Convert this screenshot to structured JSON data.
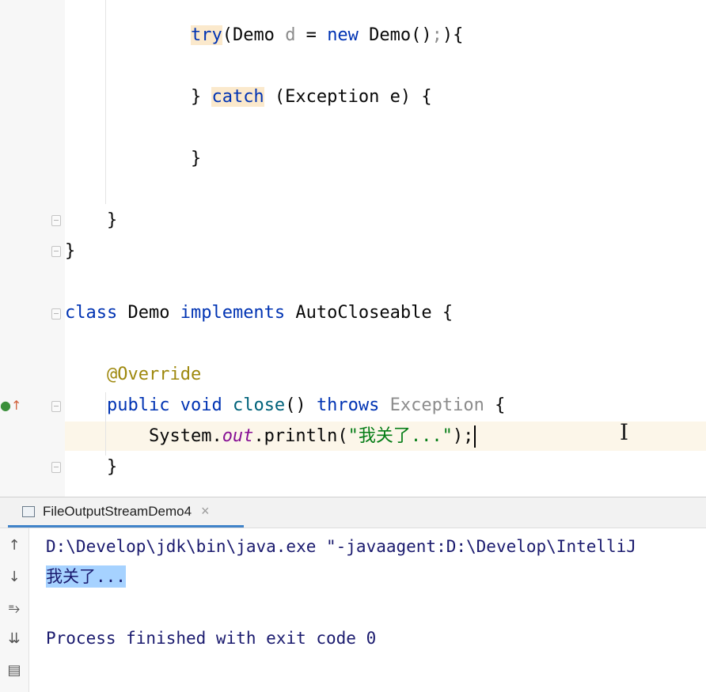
{
  "editor": {
    "lines": {
      "l1": {
        "kw_try": "try",
        "a": "(Demo ",
        "var_d": "d",
        "b": " = ",
        "kw_new": "new",
        "c": " Demo()",
        "semi": ";",
        "d": "){"
      },
      "l2": {
        "a": "} ",
        "kw_catch": "catch",
        "b": " (Exception e) {"
      },
      "l3": {
        "a": "}"
      },
      "l4": {
        "a": "}"
      },
      "l5": {
        "a": "}"
      },
      "l6": {
        "kw_class": "class",
        "a": " Demo ",
        "kw_impl": "implements",
        "b": " AutoCloseable {"
      },
      "l7": {
        "anno": "@Override"
      },
      "l8": {
        "kw_public": "public",
        "kw_void": "void",
        "m": "close",
        "a": "() ",
        "kw_throws": "throws",
        "exc": "Exception",
        "b": " {"
      },
      "l9": {
        "a": "System.",
        "field": "out",
        "b": ".println(",
        "str": "\"我关了...\"",
        "c": ");"
      },
      "l10": {
        "a": "}"
      }
    },
    "gutter_icon": "implements-method-icon"
  },
  "run_panel": {
    "tab_label": "FileOutputStreamDemo4",
    "tab_close": "×",
    "console": {
      "line1": "D:\\Develop\\jdk\\bin\\java.exe \"-javaagent:D:\\Develop\\IntelliJ",
      "line2": "我关了...",
      "line3": "Process finished with exit code 0"
    },
    "tools": [
      "up-arrow-icon",
      "down-arrow-icon",
      "soft-wrap-icon",
      "scroll-to-end-icon",
      "print-icon"
    ]
  }
}
